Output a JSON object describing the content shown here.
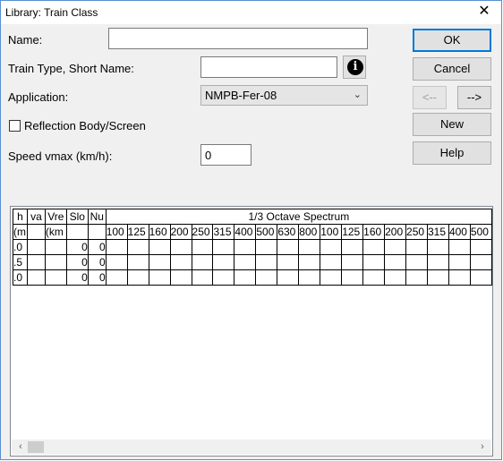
{
  "window": {
    "title": "Library: Train Class",
    "close_glyph": "✕"
  },
  "form": {
    "name_label": "Name:",
    "name_value": "",
    "train_type_label": "Train Type, Short Name:",
    "train_type_value": "",
    "application_label": "Application:",
    "application_value": "NMPB-Fer-08",
    "reflection_label": "Reflection Body/Screen",
    "reflection_checked": false,
    "speed_label": "Speed vmax (km/h):",
    "speed_value": "0"
  },
  "buttons": {
    "ok": "OK",
    "cancel": "Cancel",
    "prev": "<--",
    "next": "-->",
    "new": "New",
    "help": "Help"
  },
  "table": {
    "header_row1": [
      "h",
      "va",
      "Vre",
      "Slo",
      "Nu"
    ],
    "octave_title": "1/3 Octave Spectrum",
    "header_row2": [
      "(m",
      "",
      "(km",
      "",
      ""
    ],
    "frequencies": [
      "100",
      "125",
      "160",
      "200",
      "250",
      "315",
      "400",
      "500",
      "630",
      "800",
      "100",
      "125",
      "160",
      "200",
      "250",
      "315",
      "400",
      "500"
    ],
    "rows": [
      {
        "h": ".0",
        "va": "",
        "vre": "",
        "slo": "0",
        "nu": "0"
      },
      {
        "h": ".5",
        "va": "",
        "vre": "",
        "slo": "0",
        "nu": "0"
      },
      {
        "h": ".0",
        "va": "",
        "vre": "",
        "slo": "0",
        "nu": "0"
      }
    ]
  },
  "scrollbar": {
    "left_glyph": "‹",
    "right_glyph": "›"
  }
}
